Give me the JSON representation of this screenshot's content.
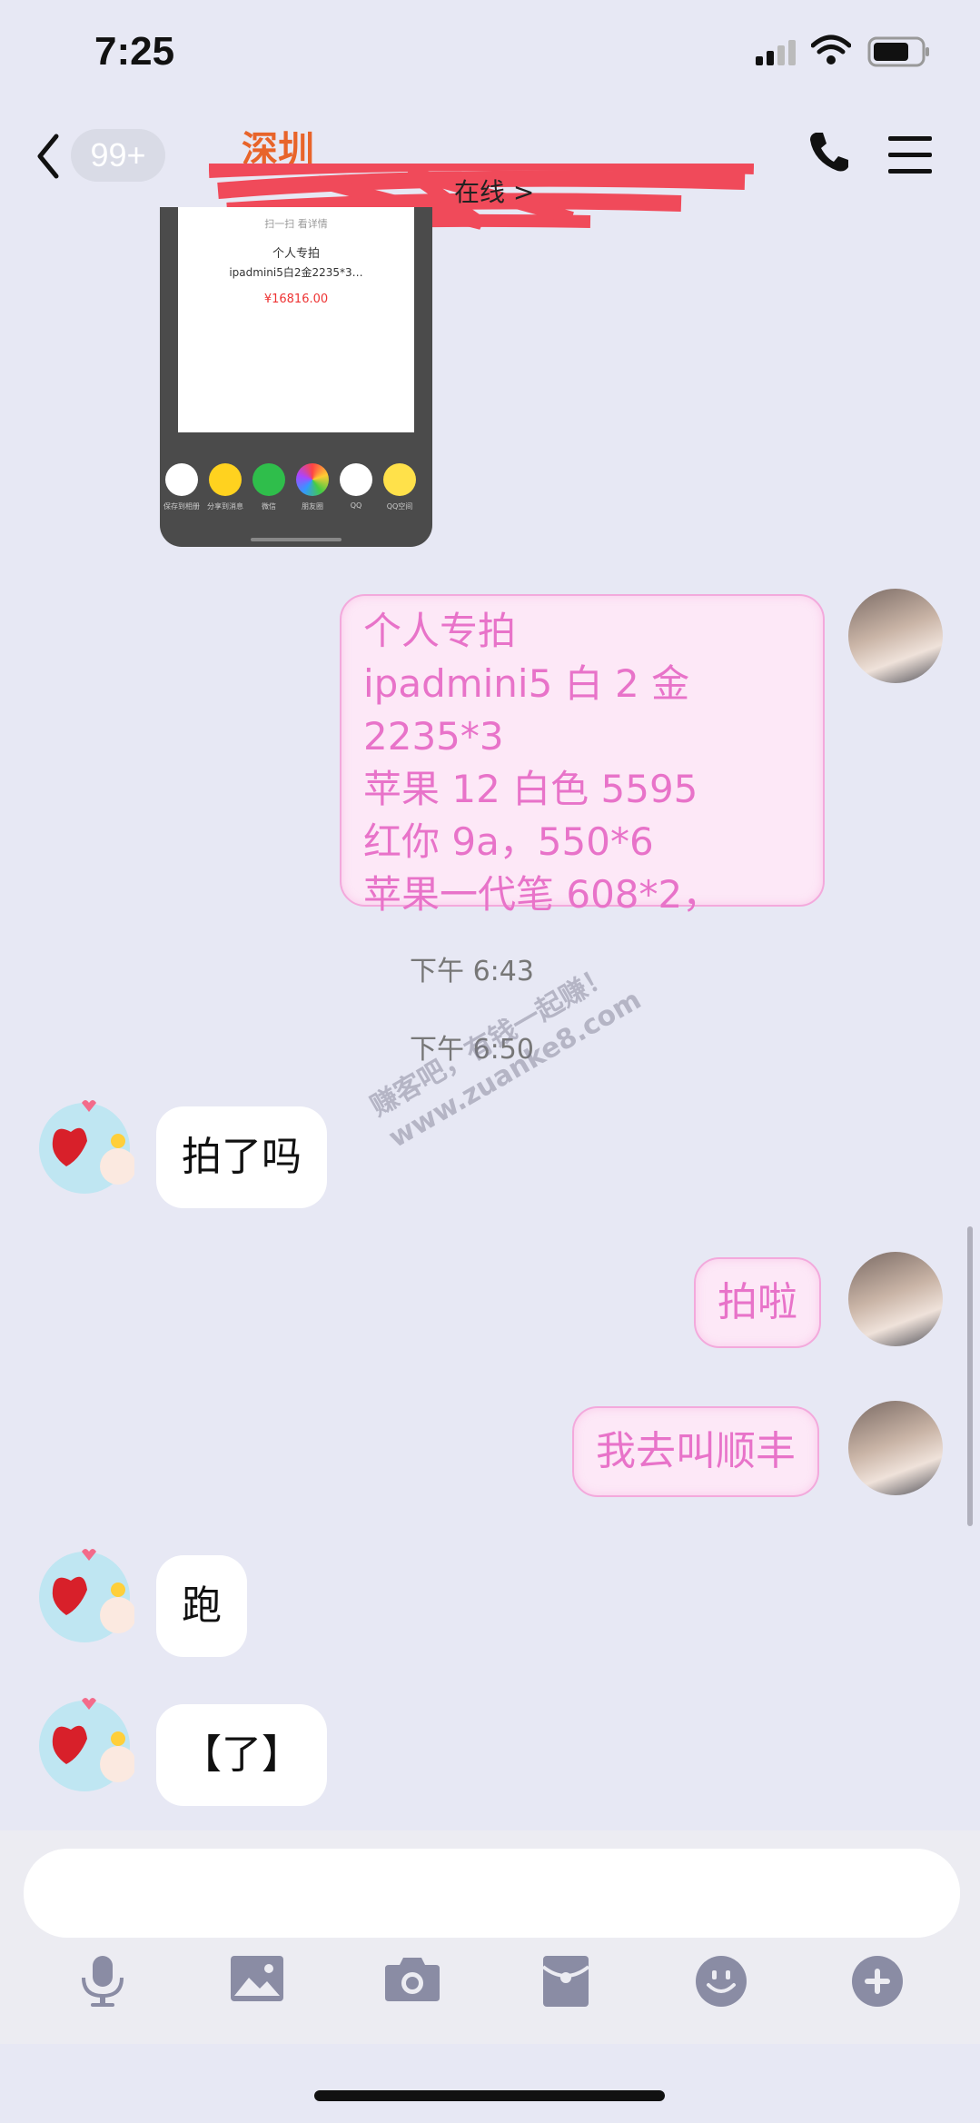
{
  "status_bar": {
    "time": "7:25"
  },
  "header": {
    "unread_badge": "99+",
    "title": "深圳",
    "presence": "在线 >"
  },
  "shared_card": {
    "hint": "扫一扫  看详情",
    "heading": "个人专拍",
    "subtitle": "ipadmini5白2金2235*3…",
    "price": "¥16816.00",
    "share_options": [
      {
        "label": "保存到相册",
        "icon": "download-icon",
        "color": "#ffffff"
      },
      {
        "label": "分享到消息",
        "icon": "yellow-app-icon",
        "color": "#ffd21f"
      },
      {
        "label": "微信",
        "icon": "wechat-icon",
        "color": "#2fbe4b"
      },
      {
        "label": "朋友圈",
        "icon": "moments-icon",
        "color": "#ffffff"
      },
      {
        "label": "QQ",
        "icon": "qq-icon",
        "color": "#ffffff"
      },
      {
        "label": "QQ空间",
        "icon": "qzone-icon",
        "color": "#ffe14a"
      }
    ]
  },
  "messages": {
    "m1_lines": [
      "个人专拍",
      "ipadmini5 白 2 金 2235*3",
      "苹果 12 白色 5595",
      "红你 9a，550*6",
      "苹果一代笔 608*2，"
    ],
    "ts1": "下午 6:43",
    "ts2": "下午 6:50",
    "m2": "拍了吗",
    "m3": "拍啦",
    "m4": "我去叫顺丰",
    "m5": "跑",
    "m6": "【了】"
  },
  "watermark": {
    "line1": "赚客吧，有钱一起赚！",
    "line2": "www.zuanke8.com"
  },
  "toolbar": {
    "icons": [
      "microphone-icon",
      "image-icon",
      "camera-icon",
      "red-packet-icon",
      "emoji-icon",
      "plus-icon"
    ]
  },
  "colors": {
    "accent_pink": "#e873c9",
    "title_orange": "#e8642a"
  }
}
